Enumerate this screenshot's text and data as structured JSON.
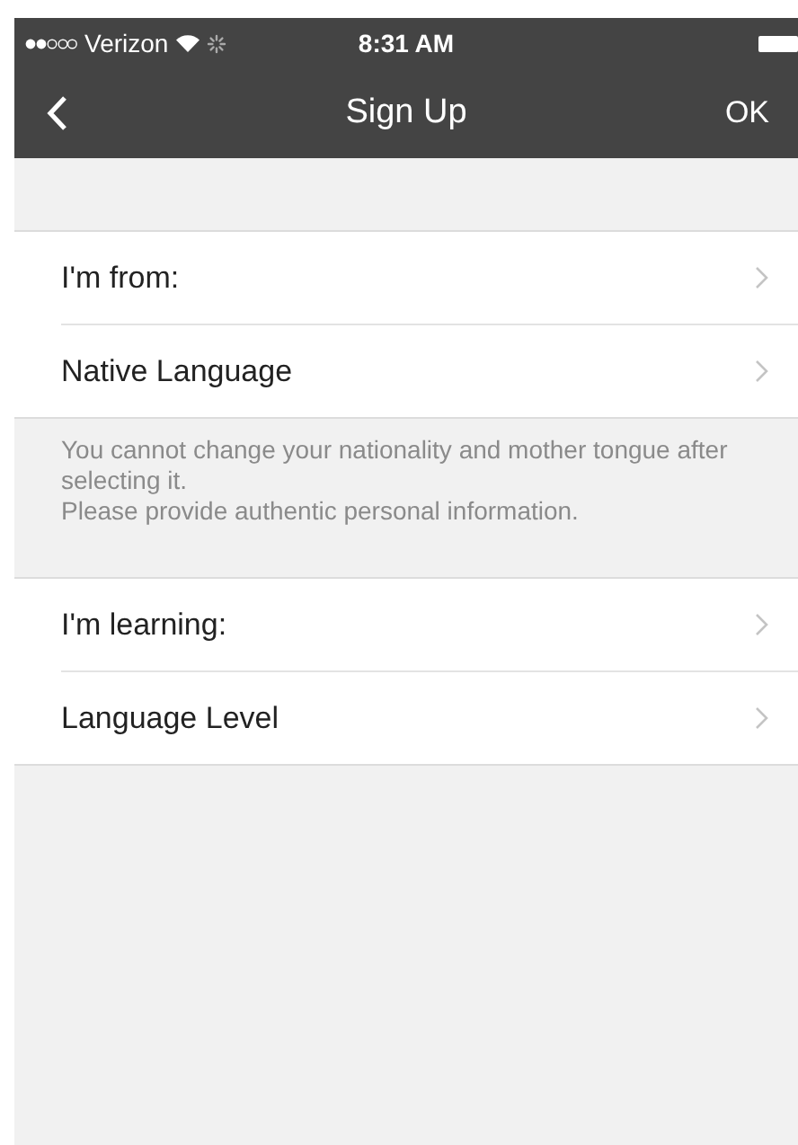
{
  "status_bar": {
    "carrier": "Verizon",
    "time": "8:31 AM"
  },
  "nav": {
    "title": "Sign Up",
    "action": "OK"
  },
  "groups": [
    {
      "rows": [
        {
          "label": "I'm from:"
        },
        {
          "label": "Native Language"
        }
      ],
      "footer": [
        "You cannot change your nationality and mother tongue after selecting it.",
        "Please provide authentic personal information."
      ]
    },
    {
      "rows": [
        {
          "label": "I'm learning:"
        },
        {
          "label": "Language Level"
        }
      ]
    }
  ]
}
